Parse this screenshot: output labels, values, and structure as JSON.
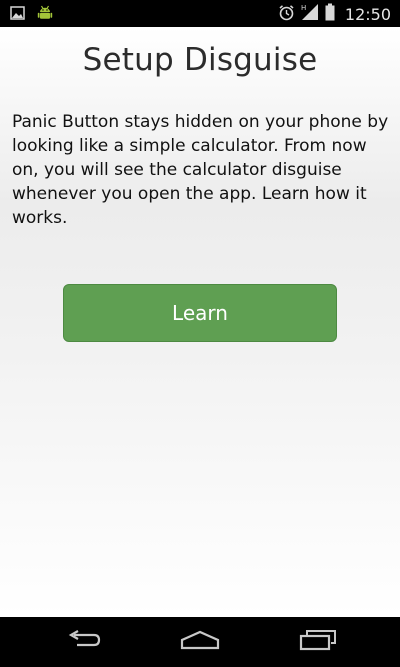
{
  "status_bar": {
    "time": "12:50",
    "icons": [
      "image-notification-icon",
      "android-notification-icon",
      "alarm-icon",
      "signal-icon",
      "battery-icon"
    ]
  },
  "main": {
    "title": "Setup Disguise",
    "description": "Panic Button stays hidden on your phone by looking like a simple calculator. From now on, you will see the calculator disguise whenever you open the app. Learn how it works.",
    "learn_button_label": "Learn"
  },
  "nav_bar": {
    "icons": [
      "back-icon",
      "home-icon",
      "recent-apps-icon"
    ]
  },
  "colors": {
    "button_green": "#5f9f52",
    "android_green": "#a4c639",
    "bar_black": "#000000",
    "title_text": "#2c2c2c"
  }
}
